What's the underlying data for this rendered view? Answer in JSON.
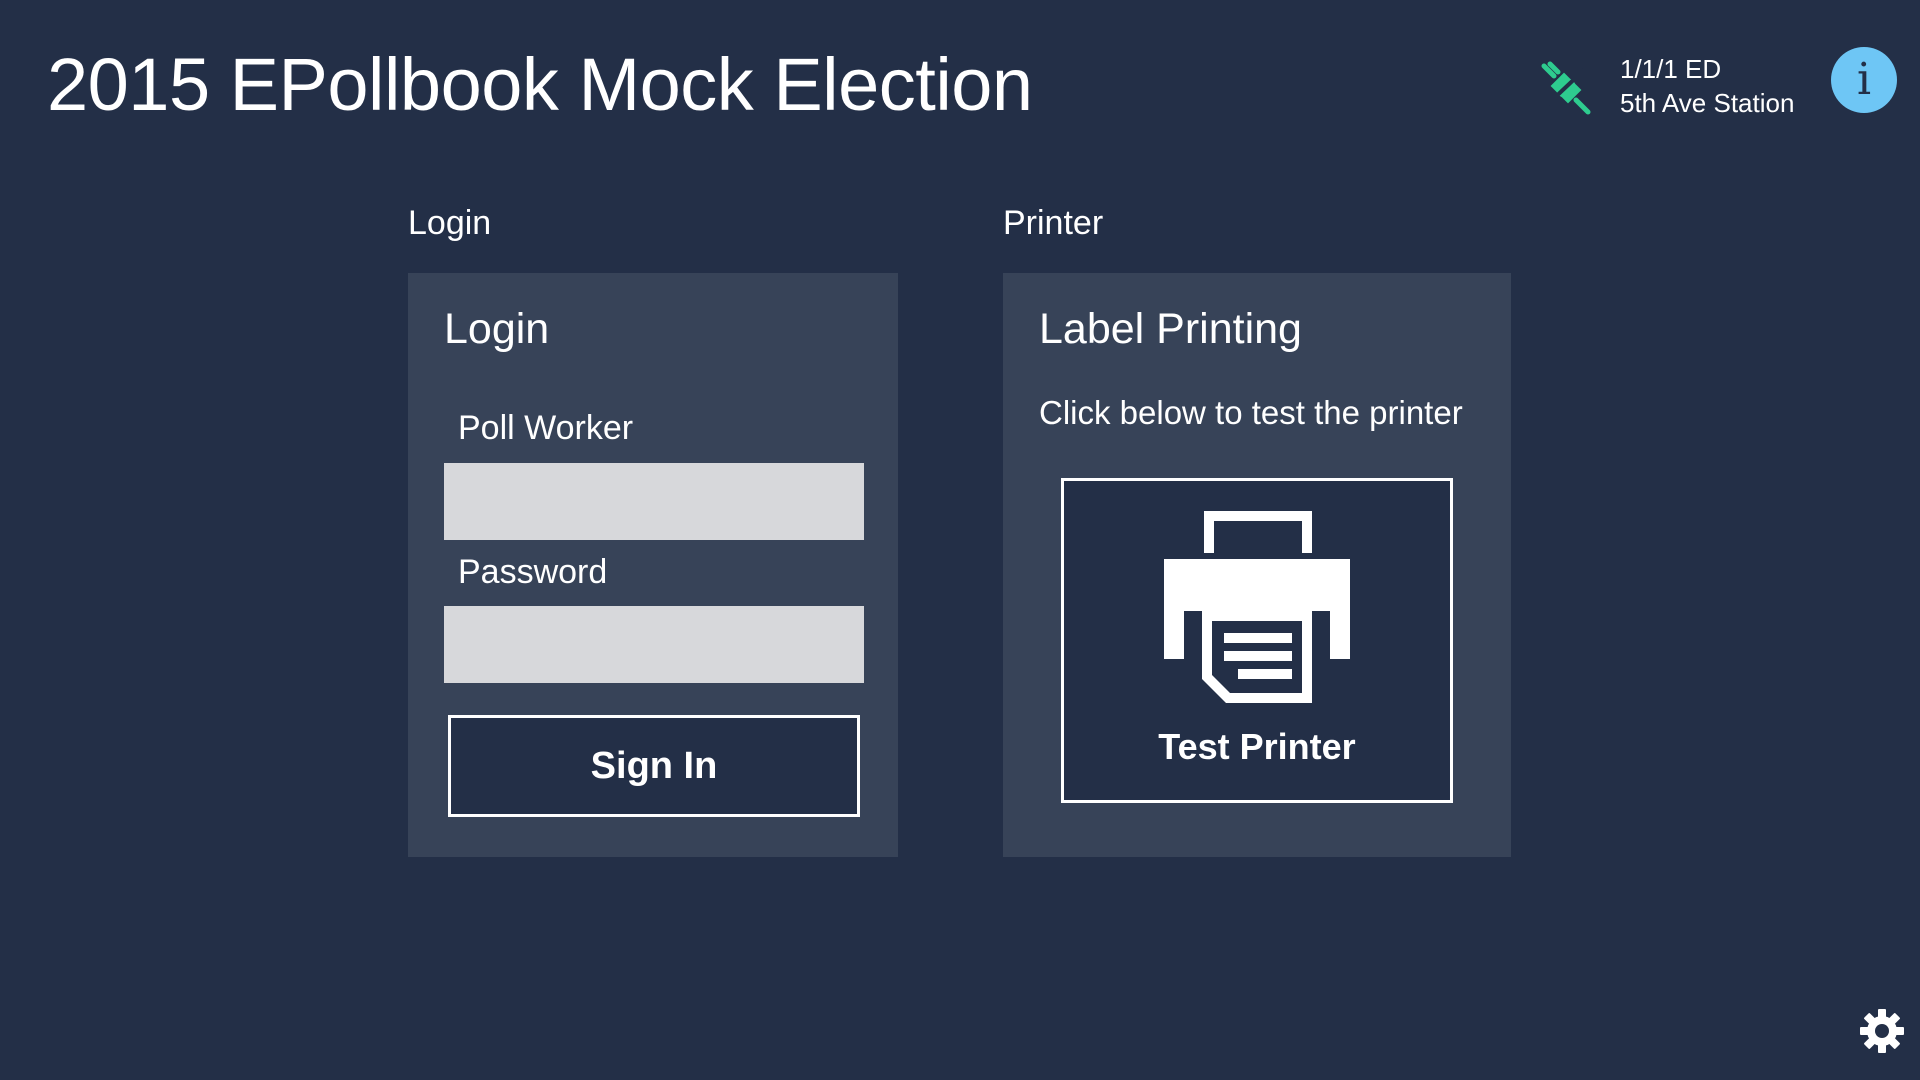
{
  "header": {
    "title": "2015 EPollbook Mock Election",
    "status_icon": "disconnected-plug-icon",
    "station_line1": "1/1/1 ED",
    "station_line2": "5th Ave Station",
    "info_button_glyph": "i"
  },
  "login_section": {
    "heading": "Login",
    "panel_title": "Login",
    "poll_worker_label": "Poll Worker",
    "poll_worker_value": "",
    "password_label": "Password",
    "password_value": "",
    "sign_in_label": "Sign In"
  },
  "printer_section": {
    "heading": "Printer",
    "panel_title": "Label Printing",
    "description": "Click below to test the printer",
    "test_button_label": "Test Printer",
    "test_button_icon": "printer-icon"
  },
  "footer": {
    "settings_icon": "gear-icon"
  },
  "colors": {
    "background": "#232f47",
    "panel": "#374358",
    "input": "#d7d8db",
    "accent_info": "#6ec6f5",
    "status_green": "#2ecc8f"
  }
}
